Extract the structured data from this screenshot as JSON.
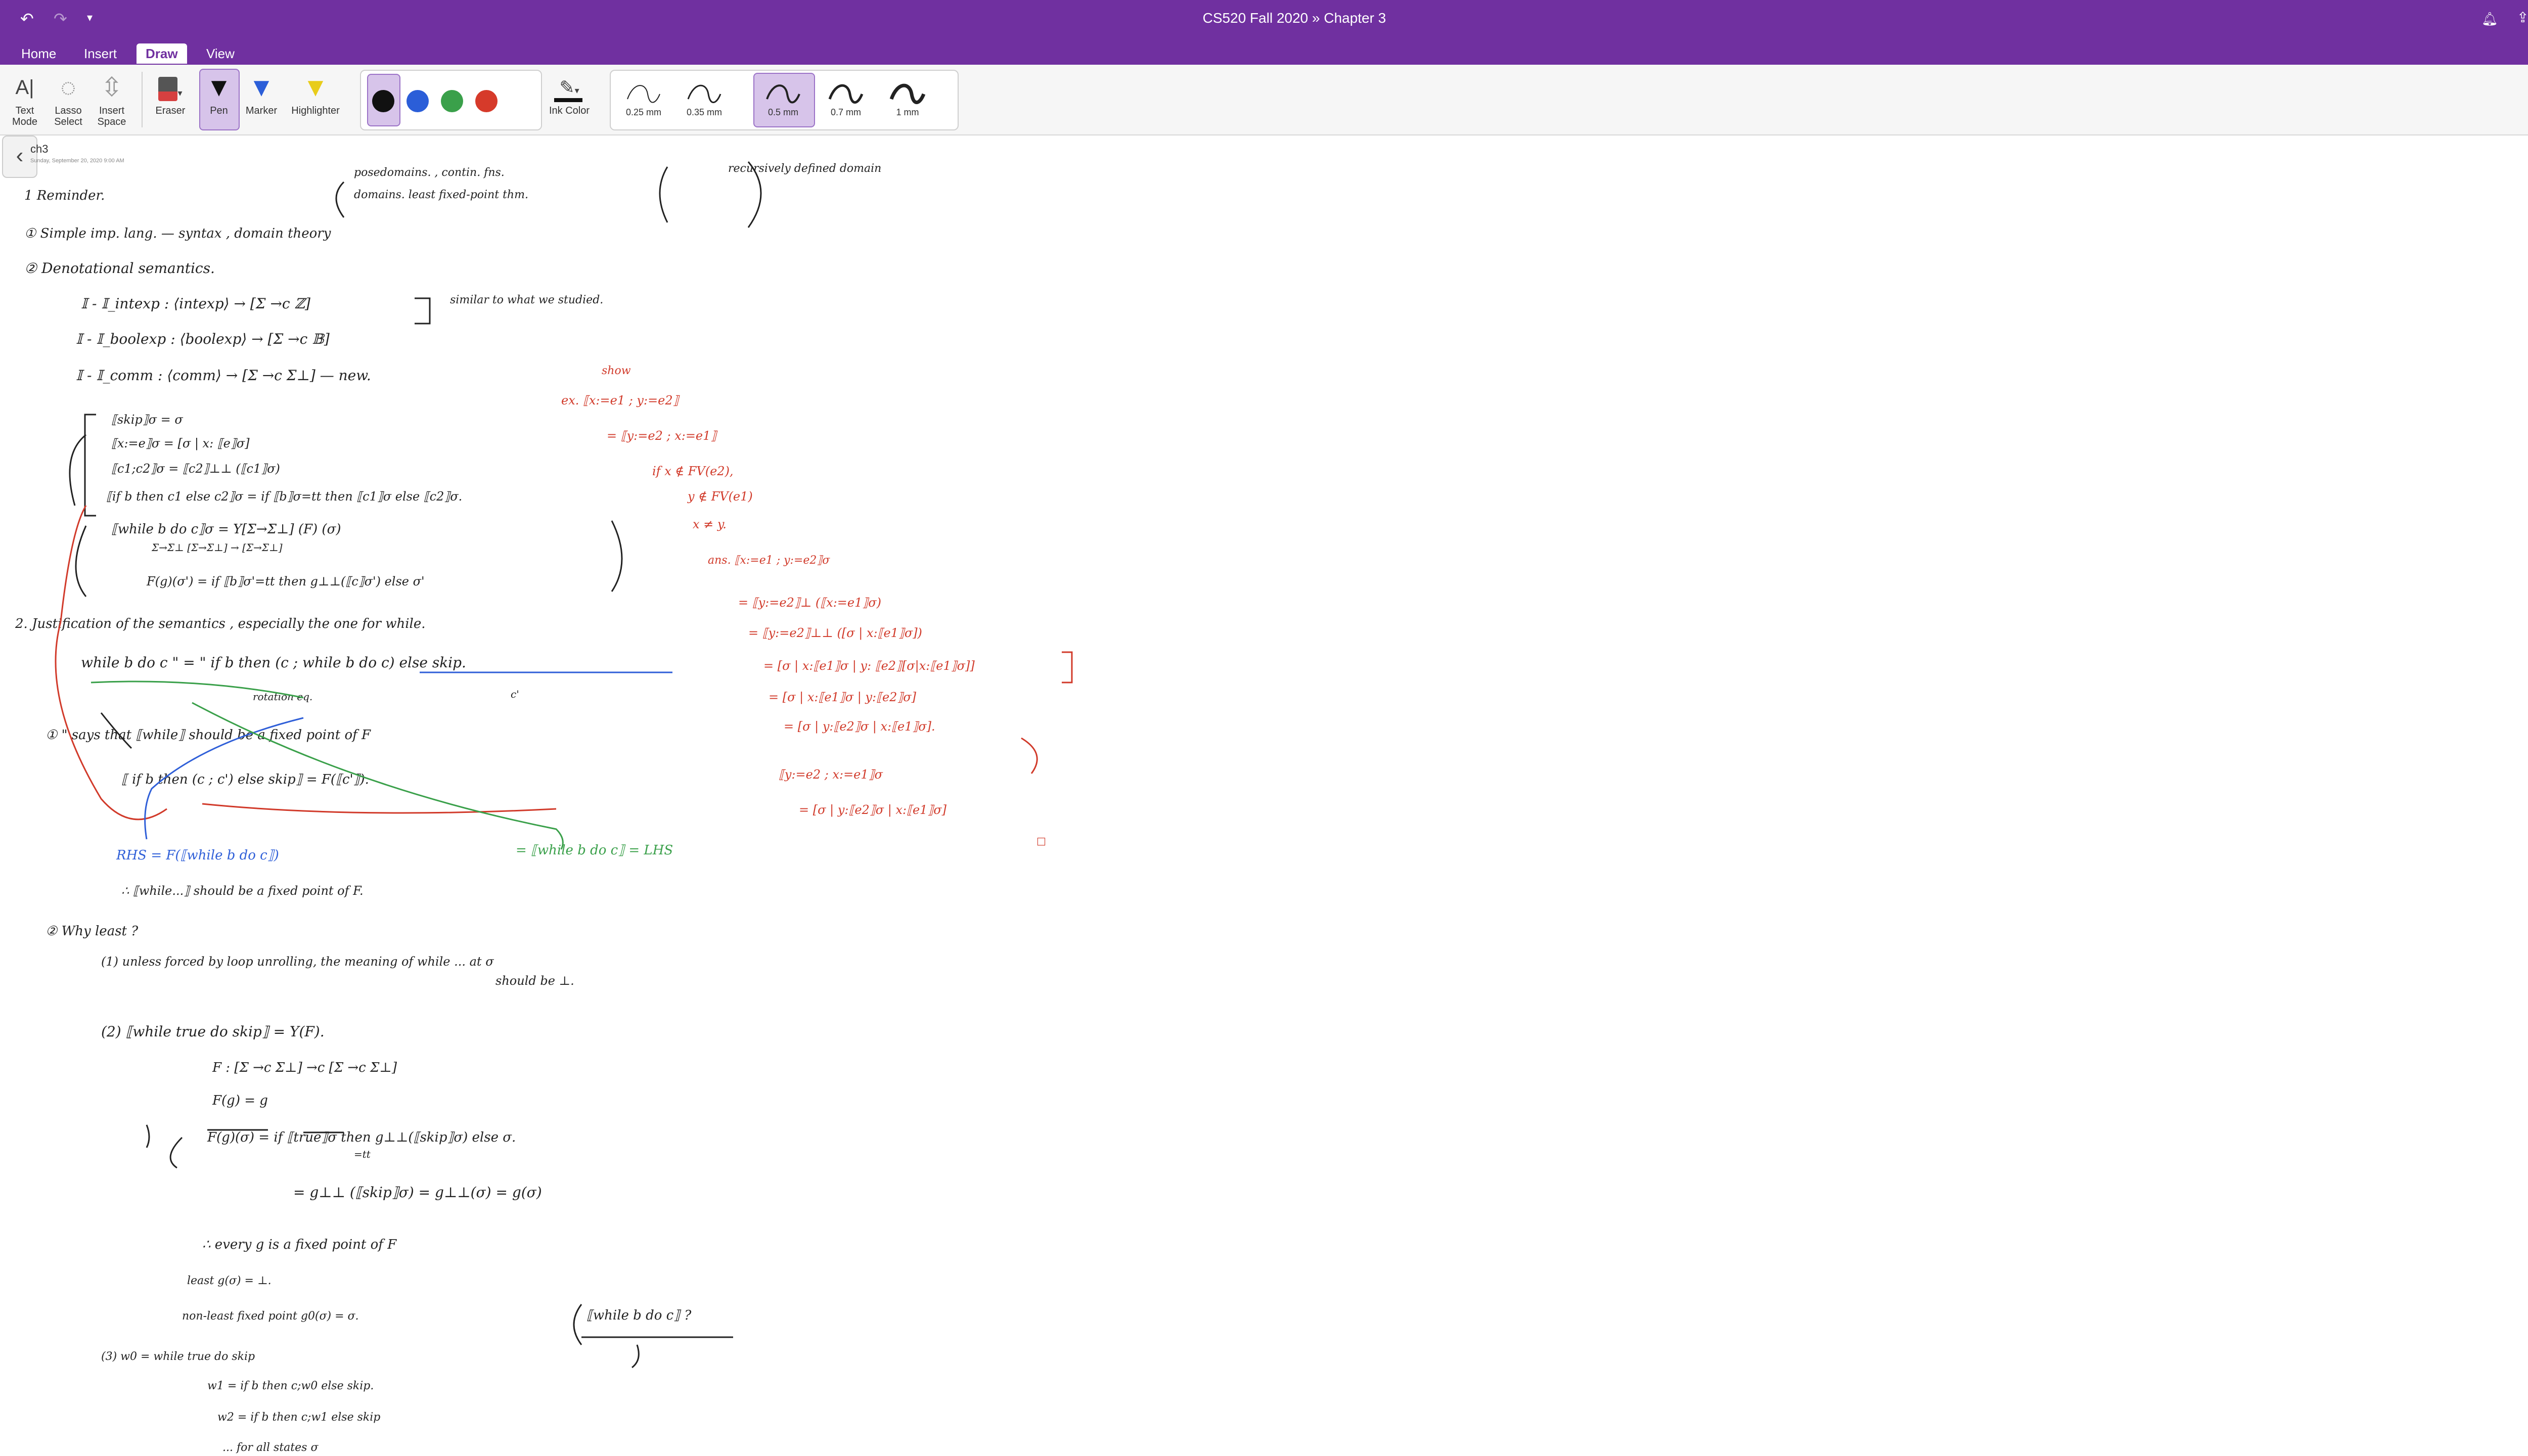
{
  "window": {
    "notebook": "CS520 Fall 2020",
    "separator": "»",
    "section": "Chapter 3"
  },
  "tabs": [
    "Home",
    "Insert",
    "Draw",
    "View"
  ],
  "active_tab": "Draw",
  "ribbon": {
    "text_mode": "Text Mode",
    "lasso_select": "Lasso Select",
    "insert_space": "Insert Space",
    "eraser": "Eraser",
    "pen": "Pen",
    "marker": "Marker",
    "highlighter": "Highlighter",
    "ink_color": "Ink Color",
    "pen_colors": [
      "#111111",
      "#2b5ed8",
      "#3aa04a",
      "#d63a2a"
    ],
    "thickness": [
      "0.25 mm",
      "0.35 mm",
      "0.5 mm",
      "0.7 mm",
      "1 mm"
    ],
    "selected_thickness": "0.5 mm"
  },
  "page": {
    "title": "ch3",
    "date": "Sunday, September 20, 2020    9:00 AM"
  },
  "notes": {
    "black": [
      {
        "text": "1  Reminder."
      },
      {
        "text": "① Simple imp. lang.  — syntax , domain theory"
      },
      {
        "text": "posedomains.  , contin. fns."
      },
      {
        "text": "domains.   least fixed-point thm."
      },
      {
        "text": "recursively defined domain"
      },
      {
        "text": "② Denotational semantics."
      },
      {
        "text": "𝕀 - 𝕀_intexp : ⟨intexp⟩ → [Σ →c ℤ]"
      },
      {
        "text": "similar to what we studied."
      },
      {
        "text": "𝕀 - 𝕀_boolexp : ⟨boolexp⟩ → [Σ →c 𝔹]"
      },
      {
        "text": "𝕀 - 𝕀_comm : ⟨comm⟩ → [Σ →c Σ⊥]  — new."
      },
      {
        "text": "⟦skip⟧σ = σ"
      },
      {
        "text": "⟦x:=e⟧σ = [σ | x: ⟦e⟧σ]"
      },
      {
        "text": "⟦c1;c2⟧σ = ⟦c2⟧⊥⊥ (⟦c1⟧σ)"
      },
      {
        "text": "⟦if b then c1 else c2⟧σ = if ⟦b⟧σ=tt then ⟦c1⟧σ else ⟦c2⟧σ."
      },
      {
        "text": "⟦while b do c⟧σ = Y[Σ→Σ⊥] (F) (σ)"
      },
      {
        "text": "Σ→Σ⊥       [Σ→Σ⊥] → [Σ→Σ⊥]"
      },
      {
        "text": "F(g)(σ') = if ⟦b⟧σ'=tt then g⊥⊥(⟦c⟧σ') else σ'"
      },
      {
        "text": "2.  Justification of the semantics , especially the one for while."
      },
      {
        "text": "while b do c   \" = \"   if b then (c ; while b do c) else skip."
      },
      {
        "text": "rotation eq."
      },
      {
        "text": "c'"
      },
      {
        "text": "① \" says that ⟦while⟧ should be a fixed point of F"
      },
      {
        "text": "⟦ if b then (c ; c') else skip⟧ = F(⟦c'⟧)."
      },
      {
        "text": "∴ ⟦while...⟧ should be a fixed point of F."
      },
      {
        "text": "② Why least ?"
      },
      {
        "text": "(1) unless forced by loop unrolling, the meaning of while ... at σ"
      },
      {
        "text": "should be ⊥."
      },
      {
        "text": "(2)  ⟦while true do skip⟧ = Y(F)."
      },
      {
        "text": "F : [Σ →c Σ⊥] →c [Σ →c Σ⊥]"
      },
      {
        "text": "F(g) = g"
      },
      {
        "text": "F(g)(σ) = if ⟦true⟧σ then g⊥⊥(⟦skip⟧σ) else σ."
      },
      {
        "text": "=tt"
      },
      {
        "text": "= g⊥⊥ (⟦skip⟧σ)  =  g⊥⊥(σ) = g(σ)"
      },
      {
        "text": "∴ every g is a fixed point of F"
      },
      {
        "text": "least   g(σ) = ⊥."
      },
      {
        "text": "non-least fixed point   g0(σ) = σ."
      },
      {
        "text": "⟦while b do c⟧ ?"
      },
      {
        "text": "(3)   w0 = while true do skip"
      },
      {
        "text": "w1 = if b then c;w0 else skip."
      },
      {
        "text": "w2 = if b then c;w1 else skip"
      },
      {
        "text": "... for all states σ"
      }
    ],
    "red": [
      {
        "text": "show"
      },
      {
        "text": "ex.  ⟦x:=e1 ; y:=e2⟧"
      },
      {
        "text": "= ⟦y:=e2 ; x:=e1⟧"
      },
      {
        "text": "if  x ∉ FV(e2),"
      },
      {
        "text": "y ∉ FV(e1)"
      },
      {
        "text": "x ≠ y."
      },
      {
        "text": "ans.   ⟦x:=e1 ; y:=e2⟧σ"
      },
      {
        "text": "= ⟦y:=e2⟧⊥ (⟦x:=e1⟧σ)"
      },
      {
        "text": "= ⟦y:=e2⟧⊥⊥ ([σ | x:⟦e1⟧σ])"
      },
      {
        "text": "= [σ | x:⟦e1⟧σ | y: ⟦e2⟧[σ|x:⟦e1⟧σ]]"
      },
      {
        "text": "= [σ | x:⟦e1⟧σ | y:⟦e2⟧σ]"
      },
      {
        "text": "= [σ | y:⟦e2⟧σ | x:⟦e1⟧σ]."
      },
      {
        "text": "⟦y:=e2 ; x:=e1⟧σ"
      },
      {
        "text": "= [σ | y:⟦e2⟧σ | x:⟦e1⟧σ]"
      },
      {
        "text": "□"
      }
    ],
    "blue": [
      {
        "text": "RHS = F(⟦while b do c⟧)"
      }
    ],
    "green": [
      {
        "text": "= ⟦while b do c⟧ = LHS"
      }
    ]
  }
}
